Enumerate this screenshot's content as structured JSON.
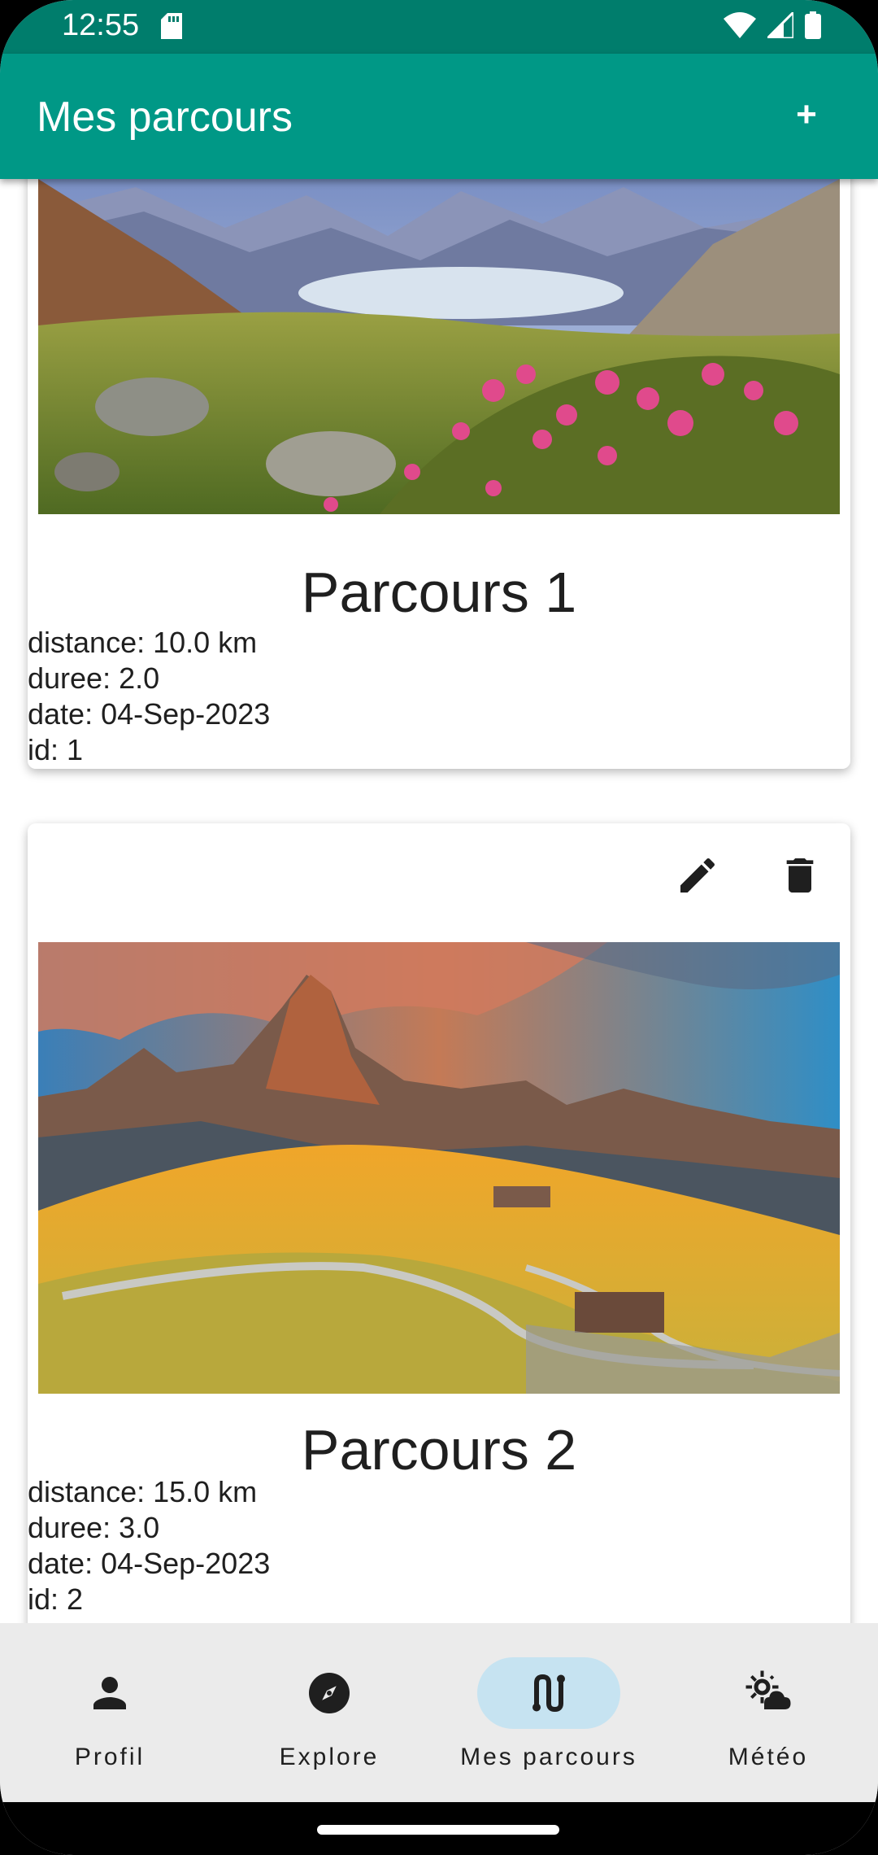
{
  "status_bar": {
    "time": "12:55"
  },
  "app_bar": {
    "title": "Mes parcours",
    "add_label": "+"
  },
  "routes": [
    {
      "name": "Parcours 1",
      "details": [
        "distance: 10.0 km",
        "duree: 2.0",
        "date: 04-Sep-2023",
        "id: 1"
      ]
    },
    {
      "name": "Parcours 2",
      "details": [
        "distance: 15.0 km",
        "duree: 3.0",
        "date: 04-Sep-2023",
        "id: 2"
      ]
    }
  ],
  "bottom_nav": {
    "items": [
      {
        "label": "Profil",
        "icon": "person-icon"
      },
      {
        "label": "Explore",
        "icon": "compass-icon"
      },
      {
        "label": "Mes parcours",
        "icon": "route-icon",
        "active": true
      },
      {
        "label": "Météo",
        "icon": "weather-icon"
      }
    ]
  },
  "colors": {
    "app_bar": "#009886",
    "status_bar": "#007d6c",
    "nav_active_pill": "#c6e3f1",
    "nav_background": "#ebebeb"
  }
}
